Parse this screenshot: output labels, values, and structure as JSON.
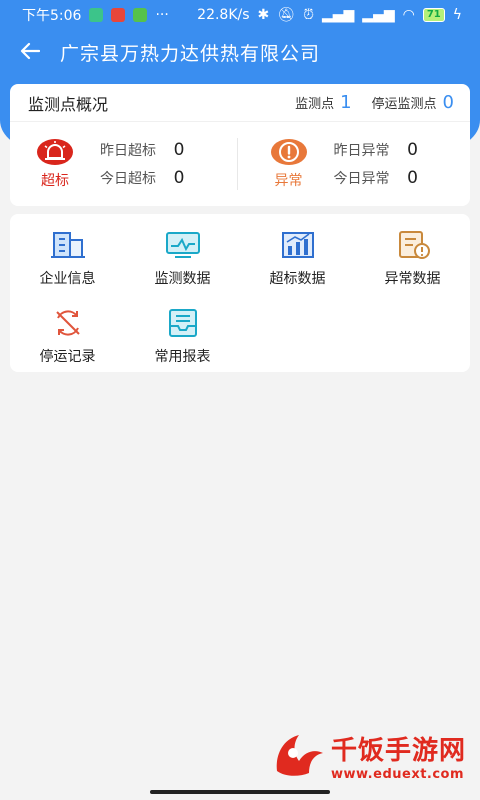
{
  "status_bar": {
    "time": "下午5:06",
    "more": "···",
    "net_speed": "22.8K/s",
    "battery": "71"
  },
  "nav": {
    "back_icon": "arrow-left-icon",
    "title": "广宗县万热力达供热有限公司"
  },
  "overview": {
    "title": "监测点概况",
    "monitor_label": "监测点",
    "monitor_count": "1",
    "stopped_label": "停运监测点",
    "stopped_count": "0",
    "exceed": {
      "label": "超标",
      "yesterday_label": "昨日超标",
      "yesterday_value": "0",
      "today_label": "今日超标",
      "today_value": "0",
      "color": "#d9261c"
    },
    "abnormal": {
      "label": "异常",
      "yesterday_label": "昨日异常",
      "yesterday_value": "0",
      "today_label": "今日异常",
      "today_value": "0",
      "color": "#e8783a"
    }
  },
  "menu": [
    {
      "label": "企业信息",
      "icon": "building-icon"
    },
    {
      "label": "监测数据",
      "icon": "monitor-icon"
    },
    {
      "label": "超标数据",
      "icon": "bar-chart-icon"
    },
    {
      "label": "异常数据",
      "icon": "warning-document-icon"
    },
    {
      "label": "停运记录",
      "icon": "stop-cycle-icon"
    },
    {
      "label": "常用报表",
      "icon": "report-inbox-icon"
    }
  ],
  "watermark": {
    "main": "千饭手游网",
    "url": "www.eduext.com"
  },
  "colors": {
    "primary": "#3a8ef0",
    "background": "#f3f3f3"
  }
}
